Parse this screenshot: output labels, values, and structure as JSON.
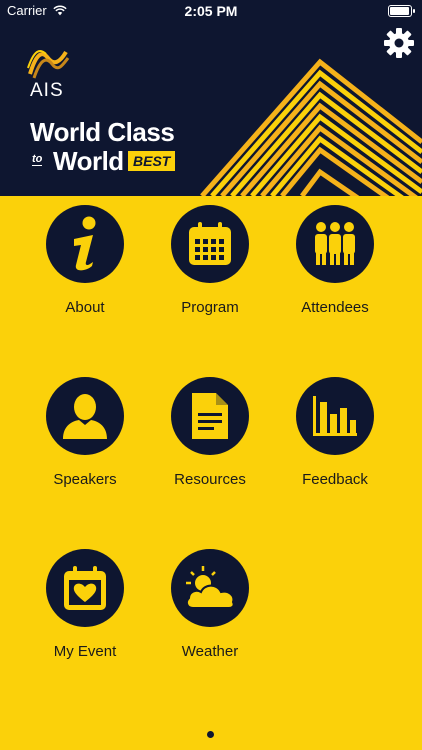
{
  "status_bar": {
    "carrier": "Carrier",
    "time": "2:05 PM"
  },
  "header": {
    "logo_text": "AIS",
    "title_line1": "World Class",
    "title_to": "to",
    "title_line2": "World",
    "title_badge": "BEST",
    "settings_icon": "gear-icon"
  },
  "colors": {
    "navy": "#0e1630",
    "yellow": "#fbd10a",
    "gold": "#f5b21a"
  },
  "tiles": [
    {
      "label": "About",
      "icon": "info-icon"
    },
    {
      "label": "Program",
      "icon": "calendar-icon"
    },
    {
      "label": "Attendees",
      "icon": "people-icon"
    },
    {
      "label": "Speakers",
      "icon": "person-icon"
    },
    {
      "label": "Resources",
      "icon": "document-icon"
    },
    {
      "label": "Feedback",
      "icon": "bar-chart-icon"
    },
    {
      "label": "My Event",
      "icon": "calendar-heart-icon"
    },
    {
      "label": "Weather",
      "icon": "weather-icon"
    }
  ],
  "pager": {
    "pages": 1,
    "current": 1
  }
}
